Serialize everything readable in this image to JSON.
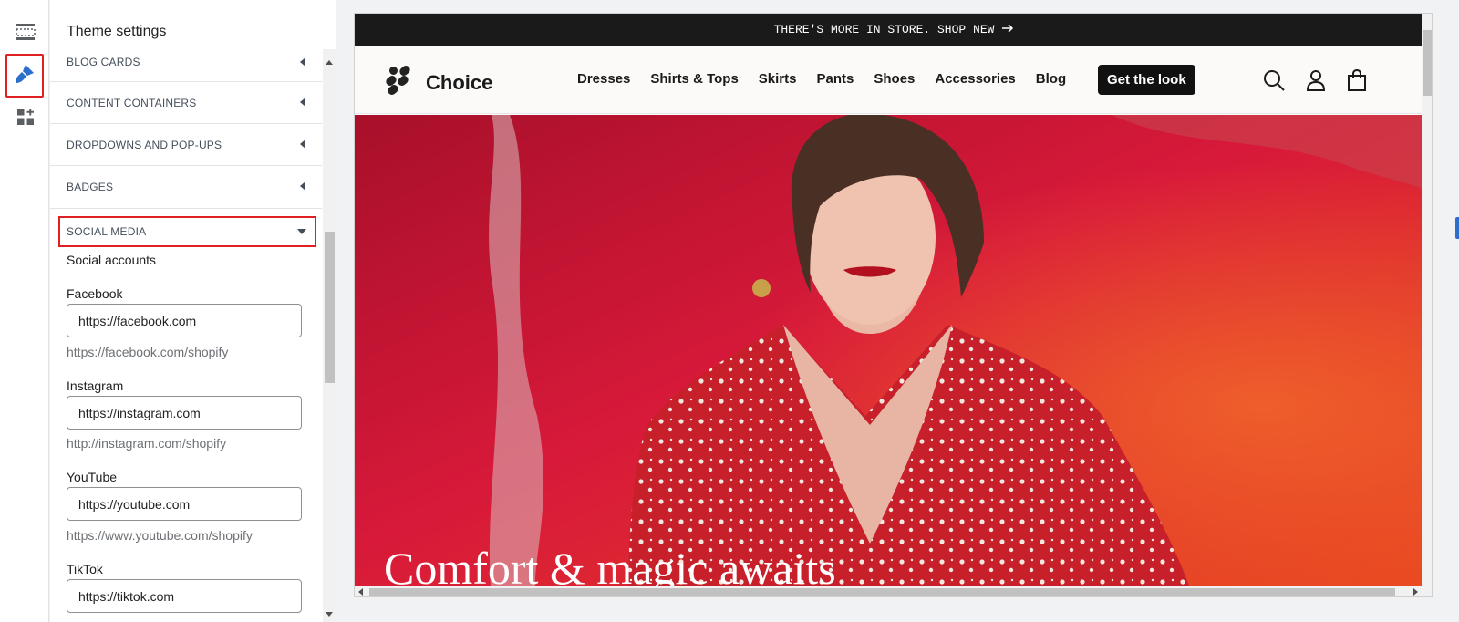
{
  "rail": {
    "items": [
      {
        "icon": "sections-icon"
      },
      {
        "icon": "theme-settings-icon",
        "active": true,
        "accent": "#2c6ecb",
        "highlight": "#e02020"
      },
      {
        "icon": "apps-icon"
      }
    ]
  },
  "panel": {
    "title": "Theme settings",
    "accordions": [
      {
        "label": "BLOG CARDS"
      },
      {
        "label": "CONTENT CONTAINERS"
      },
      {
        "label": "DROPDOWNS AND POP-UPS"
      },
      {
        "label": "BADGES"
      }
    ],
    "social": {
      "label": "SOCIAL MEDIA",
      "subheading": "Social accounts",
      "fields": [
        {
          "label": "Facebook",
          "value": "https://facebook.com",
          "help": "https://facebook.com/shopify"
        },
        {
          "label": "Instagram",
          "value": "https://instagram.com",
          "help": "http://instagram.com/shopify"
        },
        {
          "label": "YouTube",
          "value": "https://youtube.com",
          "help": "https://www.youtube.com/shopify"
        },
        {
          "label": "TikTok",
          "value": "https://tiktok.com"
        }
      ]
    }
  },
  "preview": {
    "announcement": "THERE'S MORE IN STORE. SHOP NEW",
    "brand": "Choice",
    "nav": [
      "Dresses",
      "Shirts & Tops",
      "Skirts",
      "Pants",
      "Shoes",
      "Accessories",
      "Blog"
    ],
    "cta": "Get the look",
    "header_icons": [
      "search-icon",
      "account-icon",
      "cart-icon"
    ],
    "hero_headline": "Comfort & magic awaits"
  }
}
